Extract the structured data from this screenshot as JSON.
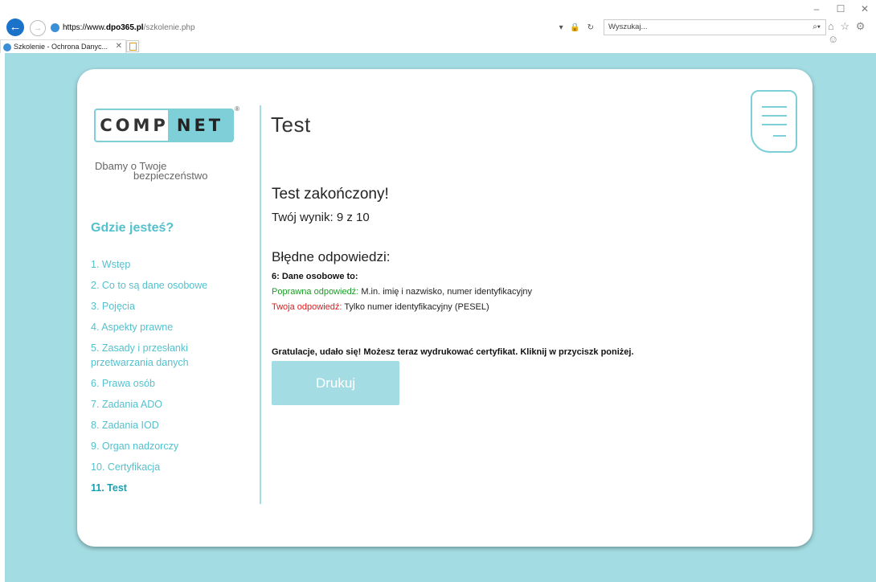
{
  "browser": {
    "window_controls": {
      "minimize": "–",
      "maximize": "☐",
      "close": "✕"
    },
    "url_proto": "https://www.",
    "url_host": "dpo365.pl",
    "url_path": "/szkolenie.php",
    "address_tools": "▾ 🔒 ↻",
    "search_placeholder": "Wyszukaj...",
    "search_icon": "⌕▾",
    "toolbar_icons": "⌂ ☆ ⚙ ☺",
    "tab_title": "Szkolenie - Ochrona Danyc...",
    "tab_close": "✕"
  },
  "sidebar": {
    "logo_left": "COMP",
    "logo_right": "NET",
    "logo_mark": "®",
    "tagline_line1": "Dbamy o Twoje",
    "tagline_line2": "bezpieczeństwo",
    "where_title": "Gdzie jesteś?",
    "items": [
      {
        "label": "1. Wstęp"
      },
      {
        "label": "2. Co to są dane osobowe"
      },
      {
        "label": "3. Pojęcia"
      },
      {
        "label": "4. Aspekty prawne"
      },
      {
        "label": "5. Zasady i przesłanki przetwarzania danych"
      },
      {
        "label": "6. Prawa osób"
      },
      {
        "label": "7. Zadania ADO"
      },
      {
        "label": "8. Zadania IOD"
      },
      {
        "label": "9. Organ nadzorczy"
      },
      {
        "label": "10. Certyfikacja"
      },
      {
        "label": "11. Test"
      }
    ],
    "active_index": 10
  },
  "main": {
    "title": "Test",
    "completed": "Test zakończony!",
    "score": "Twój wynik: 9 z 10",
    "wrong_title": "Błędne odpowiedzi:",
    "question": "6: Dane osobowe to:",
    "correct_label": "Poprawna odpowiedź:",
    "correct_value": "M.in. imię i nazwisko, numer identyfikacyjny",
    "your_label": "Twoja odpowiedź:",
    "your_value": "Tylko numer identyfikacyjny (PESEL)",
    "congrats": "Gratulacje, udało się! Możesz teraz wydrukować certyfikat. Kliknij w przyciszk poniżej.",
    "print_label": "Drukuj"
  },
  "colors": {
    "background": "#a3dde3",
    "accent": "#54c0cc",
    "correct": "#1f9a2a",
    "wrong": "#e01818"
  }
}
